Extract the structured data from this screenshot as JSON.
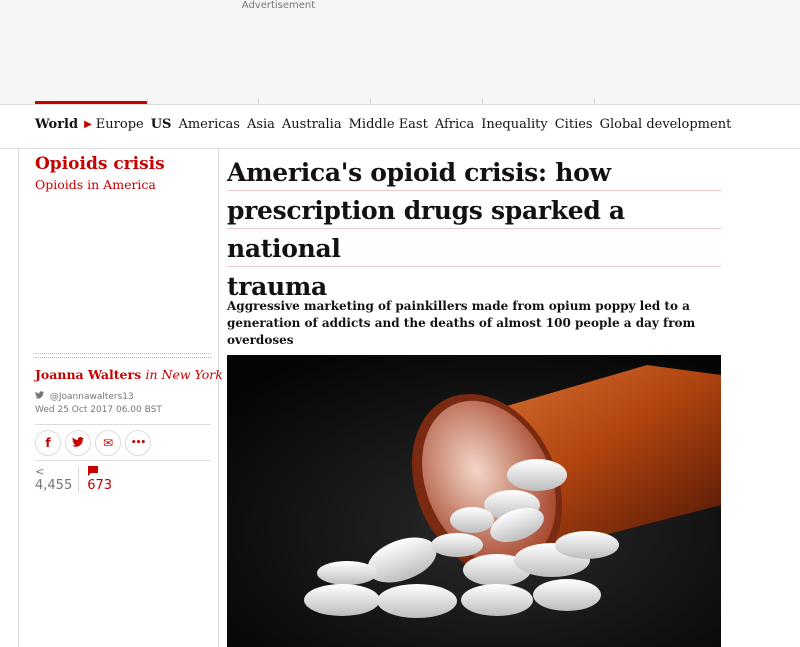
{
  "ad": {
    "label": "Advertisement"
  },
  "nav": {
    "section": "World",
    "items": [
      "Europe",
      "US",
      "Americas",
      "Asia",
      "Australia",
      "Middle East",
      "Africa",
      "Inequality",
      "Cities",
      "Global development"
    ]
  },
  "series": {
    "title": "Opioids crisis",
    "subtitle": "Opioids in America"
  },
  "article": {
    "headline_lines": [
      "America's opioid crisis: how",
      "prescription drugs sparked a national",
      "trauma"
    ],
    "standfirst_lines": [
      "Aggressive marketing of painkillers made from opium poppy led to a",
      "generation of addicts and the deaths of almost 100 people a day from",
      "overdoses"
    ]
  },
  "byline": {
    "author": "Joanna Walters",
    "location": "in New York",
    "twitter": "@Joannawalters13",
    "date": "Wed 25 Oct 2017 06.00 BST"
  },
  "share": {
    "facebook": "f",
    "twitter": "𝕥",
    "email": "✉",
    "more": "•••"
  },
  "counts": {
    "shares": "4,455",
    "comments": "673"
  },
  "colors": {
    "accent": "#c70000",
    "text": "#121212",
    "muted": "#767676"
  },
  "icons": {
    "share": "share-icon",
    "comment": "comment-icon",
    "twitter": "twitter-icon"
  }
}
